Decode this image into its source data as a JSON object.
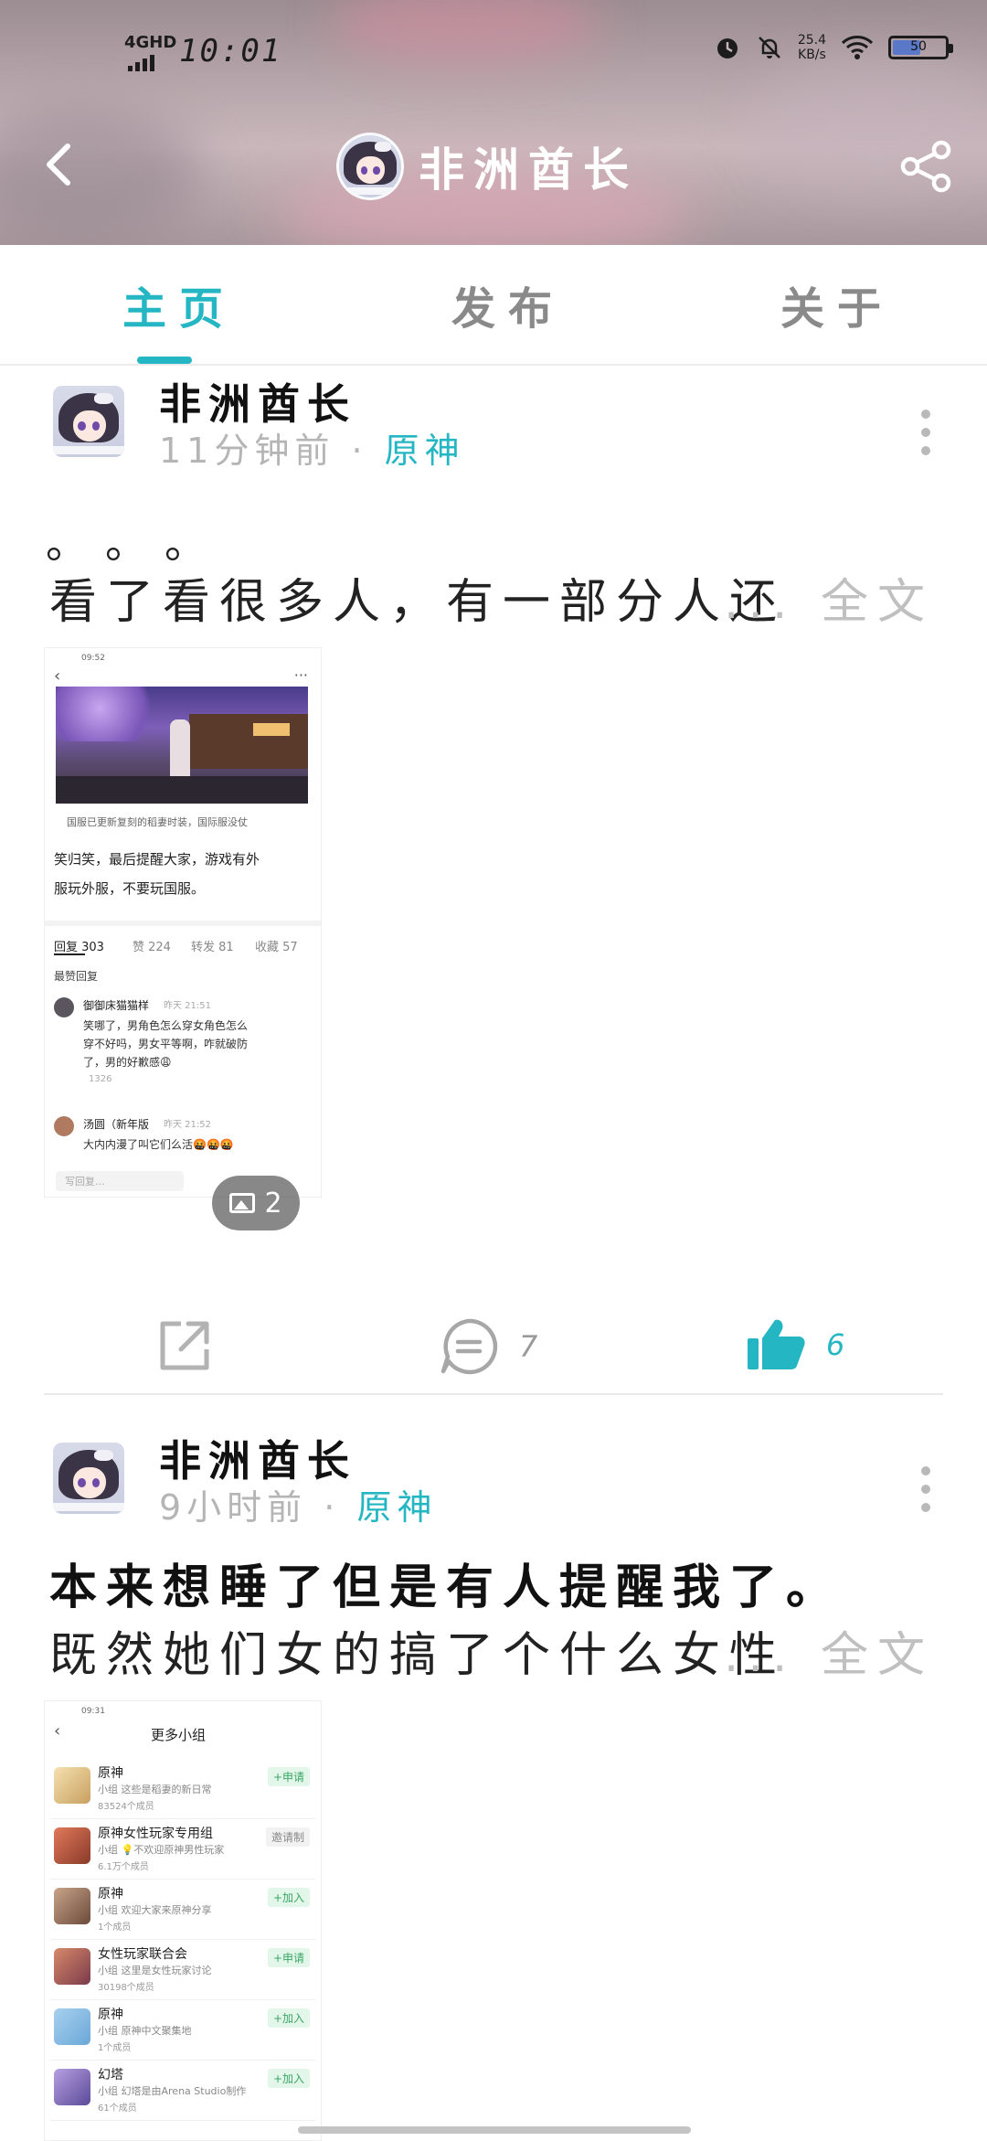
{
  "status_bar": {
    "network": "4GHD",
    "time": "10:01",
    "speed_value": "25.4",
    "speed_unit": "KB/s",
    "battery": "50"
  },
  "header": {
    "title": "非洲酋长"
  },
  "tabs": [
    {
      "label": "主页",
      "active": true
    },
    {
      "label": "发布",
      "active": false
    },
    {
      "label": "关于",
      "active": false
    }
  ],
  "posts": [
    {
      "author": "非洲酋长",
      "time": "11分钟前",
      "game": "原神",
      "text_line1": "。。。",
      "text_line2": "看了看很多人，有一部分人还",
      "full_text_label": "... 全文",
      "image_count": "2",
      "thumb": {
        "time": "09:52",
        "caption": "国服已更新复刻的稻妻时装，国际服没仗",
        "body1": "笑归笑，最后提醒大家，游戏有外",
        "body2": "服玩外服，不要玩国服。",
        "tab1": "回复 303",
        "tab2": "赞 224",
        "tab3": "转发 81",
        "tab4": "收藏 57",
        "hot": "最赞回复",
        "c1_name": "御御床猫猫样",
        "c1_time": "昨天 21:51",
        "c1_text1": "笑哪了，男角色怎么穿女角色怎么",
        "c1_text2": "穿不好吗，男女平等啊，咋就破防",
        "c1_text3": "了，男的好歉感😩",
        "c1_likes": "1326",
        "c2_name": "汤圆（新年版",
        "c2_time": "昨天 21:52",
        "c2_text": "大内内漫了叫它们么活🤬🤬🤬",
        "reply_ph": "写回复..."
      },
      "comments": "7",
      "likes": "6"
    },
    {
      "author": "非洲酋长",
      "time": "9小时前",
      "game": "原神",
      "text_line1": "本来想睡了但是有人提醒我了。",
      "text_line2": "既然她们女的搞了个什么女性",
      "full_text_label": "... 全文",
      "thumb": {
        "time": "09:31",
        "title": "更多小组",
        "groups": [
          {
            "name": "原神",
            "sub": "小组 这些是稻妻的新日常",
            "count": "83524个成员",
            "btn": "+申请"
          },
          {
            "name": "原神女性玩家专用组",
            "sub": "小组 💡不欢迎原神男性玩家",
            "count": "6.1万个成员",
            "btn": "邀请制"
          },
          {
            "name": "原神",
            "sub": "小组 欢迎大家来原神分享",
            "count": "1个成员",
            "btn": "+加入"
          },
          {
            "name": "女性玩家联合会",
            "sub": "小组 这里是女性玩家讨论",
            "count": "30198个成员",
            "btn": "+申请"
          },
          {
            "name": "原神",
            "sub": "小组 原神中文聚集地",
            "count": "1个成员",
            "btn": "+加入"
          },
          {
            "name": "幻塔",
            "sub": "小组 幻塔是由Arena Studio制作",
            "count": "61个成员",
            "btn": "+加入"
          }
        ]
      }
    }
  ],
  "colors": {
    "accent": "#25b6c3",
    "muted": "#b5b5b5"
  }
}
